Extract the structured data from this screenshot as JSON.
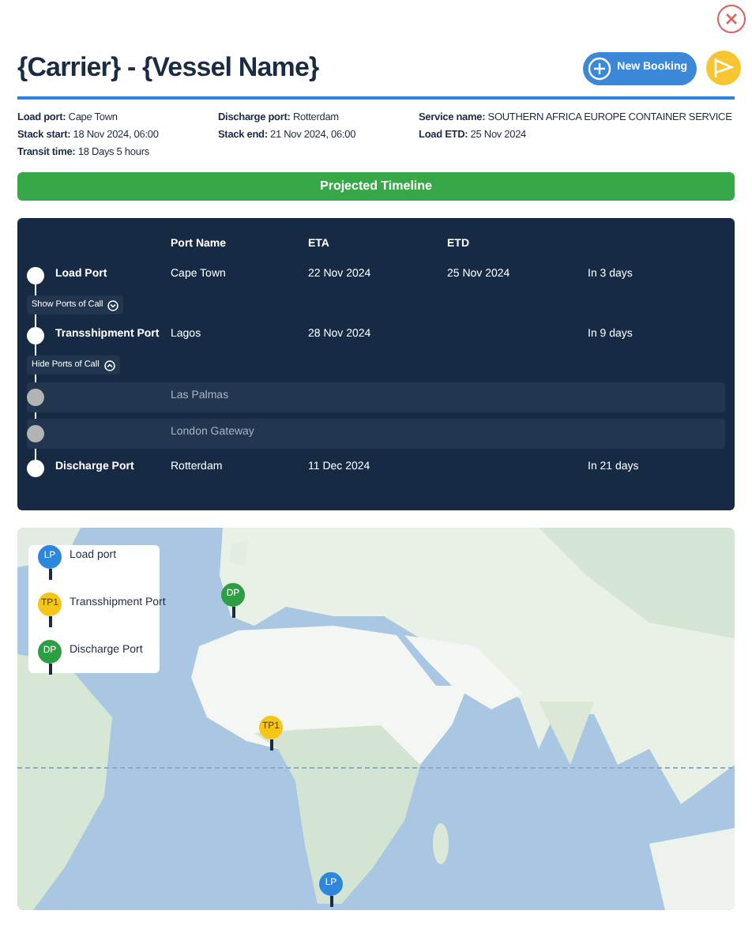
{
  "header": {
    "title": "{Carrier} - {Vessel Name}",
    "new_booking": "New Booking"
  },
  "details": [
    {
      "label": "Load port:",
      "value": "Cape Town"
    },
    {
      "label": "Discharge port:",
      "value": "Rotterdam"
    },
    {
      "label": "Service name:",
      "value": "SOUTHERN AFRICA EUROPE CONTAINER SERVICE"
    },
    {
      "label": "Stack start:",
      "value": "18 Nov 2024, 06:00"
    },
    {
      "label": "Stack end:",
      "value": "21 Nov 2024, 06:00"
    },
    {
      "label": "Load ETD:",
      "value": "25 Nov 2024"
    },
    {
      "label": "Transit time:",
      "value": "18 Days 5 hours"
    }
  ],
  "timeline_bar": "Projected Timeline",
  "timeline": {
    "columns": [
      "Port Name",
      "ETA",
      "ETD"
    ],
    "rows": [
      {
        "kind": "port",
        "label": "Load Port",
        "port_name": "Cape Town",
        "eta": "22 Nov 2024",
        "etd": "25 Nov 2024",
        "relative": "In 3 days"
      },
      {
        "kind": "toggle",
        "label": "Show Ports of Call",
        "expanded": false
      },
      {
        "kind": "port",
        "label": "Transshipment Port",
        "port_name": "Lagos",
        "eta": "28 Nov 2024",
        "relative": "In 9 days"
      },
      {
        "kind": "toggle",
        "label": "Hide Ports of Call",
        "expanded": true
      },
      {
        "kind": "call",
        "port_name": "Las Palmas"
      },
      {
        "kind": "call",
        "port_name": "London Gateway"
      },
      {
        "kind": "port",
        "label": "Discharge Port",
        "port_name": "Rotterdam",
        "eta": "11 Dec 2024",
        "relative": "In 21 days"
      }
    ]
  },
  "map": {
    "kind": "picture",
    "legend": [
      {
        "pin": "LP",
        "label": "Load port",
        "color": "#2f86dd"
      },
      {
        "pin": "TP1",
        "label": "Transshipment Port",
        "color": "#f5c518"
      },
      {
        "pin": "DP",
        "label": "Discharge Port",
        "color": "#2e9e44"
      }
    ],
    "pins": [
      {
        "label": "DP",
        "color": "#2e9e44"
      },
      {
        "label": "TP1",
        "color": "#f5c518"
      },
      {
        "label": "LP",
        "color": "#2f86dd"
      }
    ]
  }
}
